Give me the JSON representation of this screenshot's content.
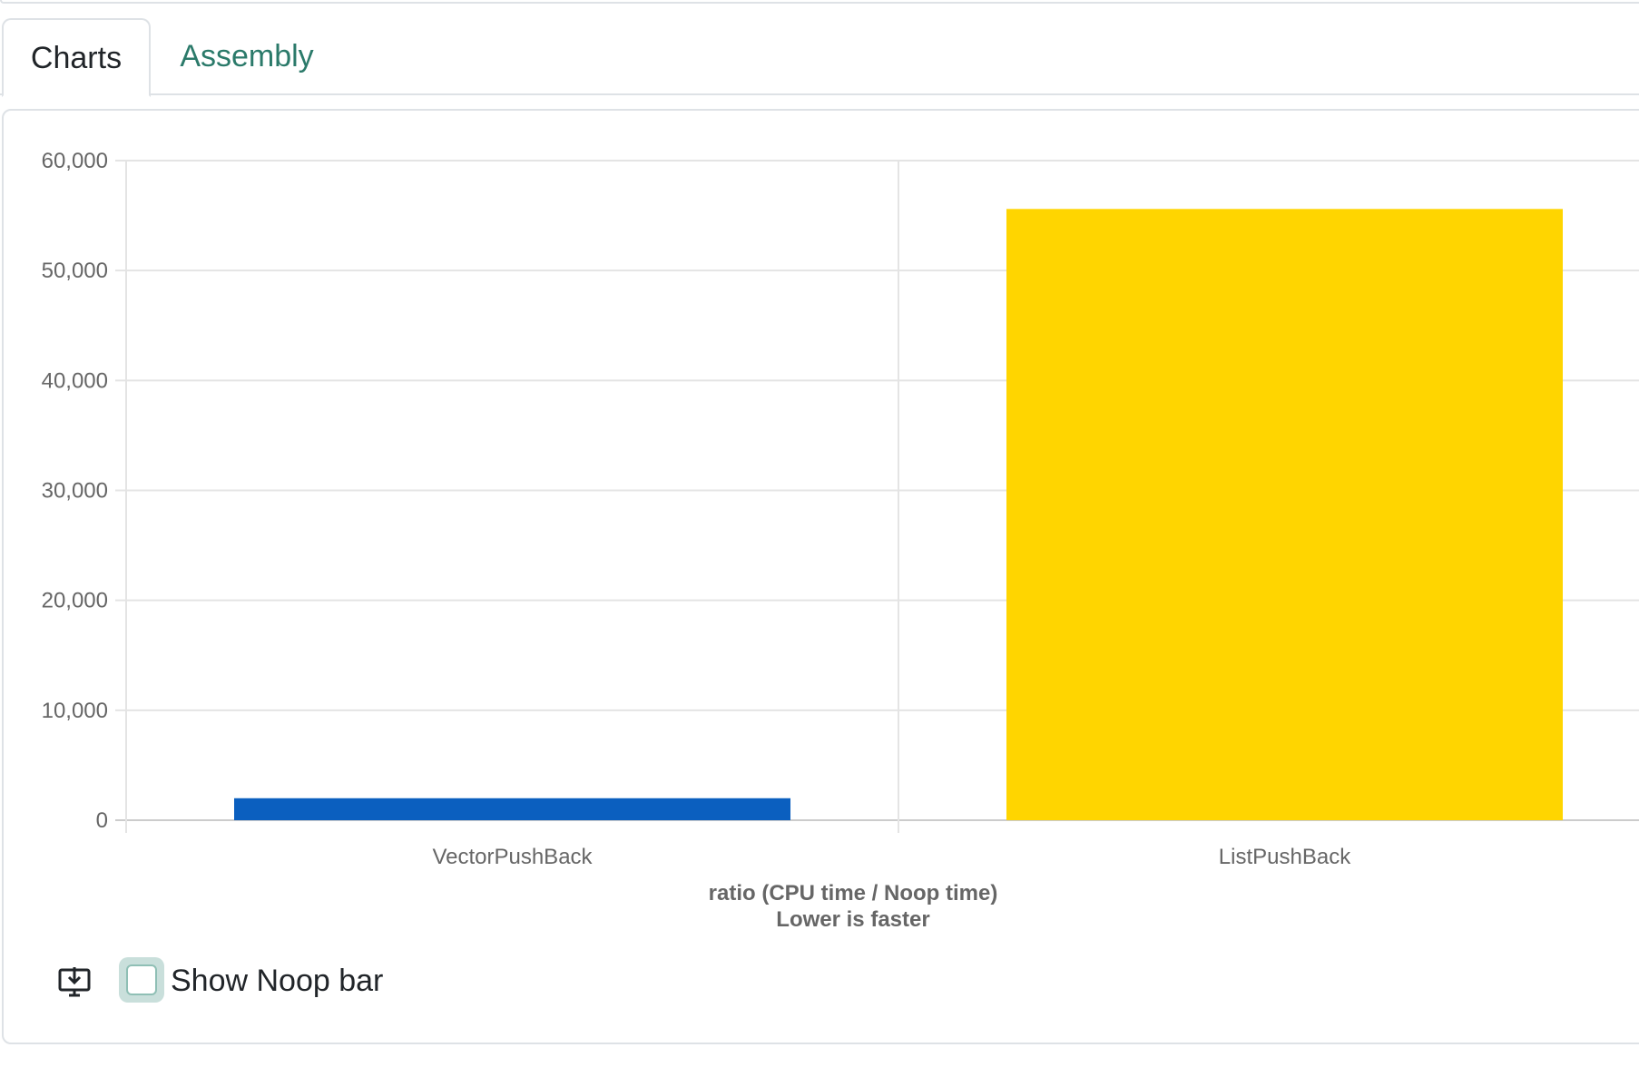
{
  "tabs": [
    {
      "label": "Charts",
      "active": true
    },
    {
      "label": "Assembly",
      "active": false
    }
  ],
  "controls": {
    "download_icon": "download-monitor-icon",
    "show_noop_label": "Show Noop bar",
    "show_noop_checked": false
  },
  "colors": {
    "vector_bar": "#0b5fbf",
    "list_bar": "#ffd500",
    "active_tab_text": "#212529",
    "inactive_tab_text": "#2b7a6a"
  },
  "chart_data": {
    "type": "bar",
    "categories": [
      "VectorPushBack",
      "ListPushBack"
    ],
    "values": [
      2000,
      55600
    ],
    "bar_colors": [
      "#0b5fbf",
      "#ffd500"
    ],
    "title": "",
    "xlabel": [
      "ratio (CPU time / Noop time)",
      "Lower is faster"
    ],
    "ylabel": "",
    "ylim": [
      0,
      60000
    ],
    "yticks": [
      "60,000",
      "50,000",
      "40,000",
      "30,000",
      "20,000",
      "10,000",
      "0"
    ],
    "grid": true,
    "legend": "none"
  }
}
